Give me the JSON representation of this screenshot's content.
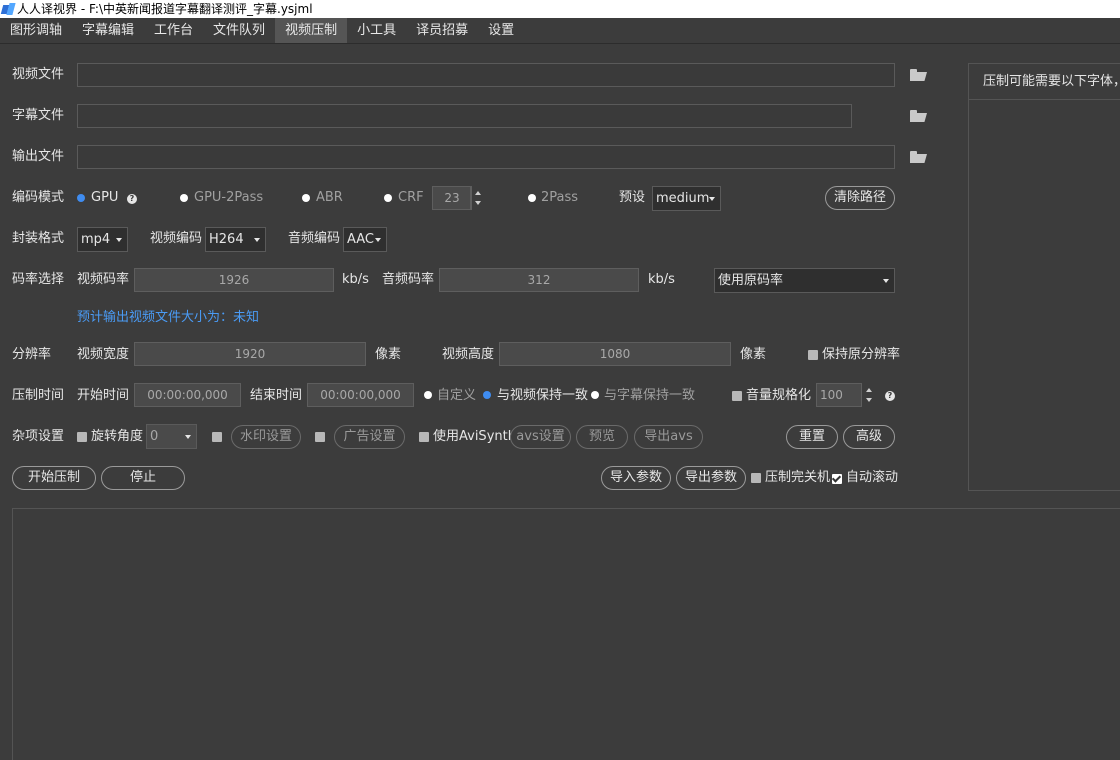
{
  "window": {
    "title": "人人译视界 - F:\\中英新闻报道字幕翻译测评_字幕.ysjml"
  },
  "menu": [
    {
      "label": "图形调轴"
    },
    {
      "label": "字幕编辑"
    },
    {
      "label": "工作台"
    },
    {
      "label": "文件队列"
    },
    {
      "label": "视频压制",
      "active": true
    },
    {
      "label": "小工具"
    },
    {
      "label": "译员招募"
    },
    {
      "label": "设置"
    }
  ],
  "files": {
    "video_label": "视频文件",
    "video_value": "",
    "subtitle_label": "字幕文件",
    "subtitle_value": "",
    "output_label": "输出文件",
    "output_value": ""
  },
  "encode": {
    "label": "编码模式",
    "options": [
      "GPU",
      "GPU-2Pass",
      "ABR",
      "CRF",
      "2Pass"
    ],
    "selected": "GPU",
    "crf_value": "23",
    "preset_label": "预设",
    "preset_value": "medium",
    "clear_paths": "清除路径"
  },
  "format": {
    "container_label": "封装格式",
    "container_value": "mp4",
    "vcodec_label": "视频编码",
    "vcodec_value": "H264",
    "acodec_label": "音频编码",
    "acodec_value": "AAC"
  },
  "bitrate": {
    "label": "码率选择",
    "video_label": "视频码率",
    "video_value": "1926",
    "video_unit": "kb/s",
    "audio_label": "音频码率",
    "audio_value": "312",
    "audio_unit": "kb/s",
    "mode_value": "使用原码率",
    "estimate": "预计输出视频文件大小为：未知"
  },
  "resolution": {
    "label": "分辨率",
    "width_label": "视频宽度",
    "width_value": "1920",
    "width_unit": "像素",
    "height_label": "视频高度",
    "height_value": "1080",
    "height_unit": "像素",
    "keep_label": "保持原分辨率"
  },
  "time": {
    "label": "压制时间",
    "start_label": "开始时间",
    "start_value": "00:00:00,000",
    "end_label": "结束时间",
    "end_value": "00:00:00,000",
    "custom": "自定义",
    "match_video": "与视频保持一致",
    "match_subtitle": "与字幕保持一致",
    "selected": "与视频保持一致",
    "normalize_label": "音量规格化",
    "normalize_value": "100"
  },
  "misc": {
    "label": "杂项设置",
    "rotate_label": "旋转角度",
    "rotate_value": "0",
    "watermark": "水印设置",
    "ad": "广告设置",
    "avisynth_label": "使用AviSynth",
    "avs_settings": "avs设置",
    "preview": "预览",
    "export_avs": "导出avs",
    "reset": "重置",
    "advanced": "高级"
  },
  "actions": {
    "start": "开始压制",
    "stop": "停止",
    "import": "导入参数",
    "export": "导出参数",
    "shutdown_label": "压制完关机",
    "shutdown_checked": false,
    "autoscroll_label": "自动滚动",
    "autoscroll_checked": true
  },
  "fonts_panel": {
    "header": "压制可能需要以下字体，请"
  }
}
